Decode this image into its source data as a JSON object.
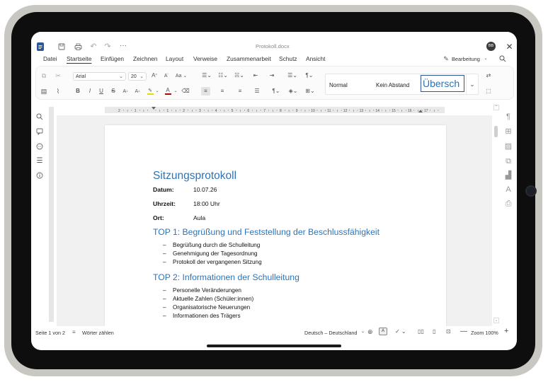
{
  "app": {
    "filename": "Protokoll.docx",
    "user_initials": "BB",
    "edit_mode": "Bearbeitung",
    "more_label": "···"
  },
  "menu": [
    "Datei",
    "Startseite",
    "Einfügen",
    "Zeichnen",
    "Layout",
    "Verweise",
    "Zusammenarbeit",
    "Schutz",
    "Ansicht"
  ],
  "ribbon": {
    "font_name": "Arial",
    "font_size": "20",
    "styles": [
      "Normal",
      "Kein Abstand",
      "Übersch"
    ]
  },
  "document": {
    "title": "Sitzungsprotokoll",
    "fields": [
      {
        "label": "Datum:",
        "value": "10.07.26"
      },
      {
        "label": "Uhrzeit:",
        "value": "18:00 Uhr"
      },
      {
        "label": "Ort:",
        "value": "Aula"
      }
    ],
    "sections": [
      {
        "heading": "TOP 1: Begrüßung und Feststellung der Beschlussfähigkeit",
        "items": [
          "Begrüßung durch die Schulleitung",
          "Genehmigung der Tagesordnung",
          "Protokoll der vergangenen Sitzung"
        ]
      },
      {
        "heading": "TOP 2: Informationen der Schulleitung",
        "items": [
          "Personelle Veränderungen",
          "Aktuelle Zahlen (Schüler:innen)",
          "Organisatorische Neuerungen",
          "Informationen des Trägers"
        ]
      }
    ],
    "bullet": "–"
  },
  "ruler_numbers": [
    "2",
    "1",
    "1",
    "2",
    "3",
    "4",
    "5",
    "6",
    "7",
    "8",
    "9",
    "10",
    "11",
    "12",
    "13",
    "14",
    "15",
    "16",
    "17"
  ],
  "status": {
    "page": "Seite 1 von 2",
    "word_count": "Wörter zählen",
    "language": "Deutsch – Deutschland",
    "zoom": "Zoom 100%"
  },
  "colors": {
    "heading": "#2e74b5",
    "accent": "#2b579a"
  }
}
